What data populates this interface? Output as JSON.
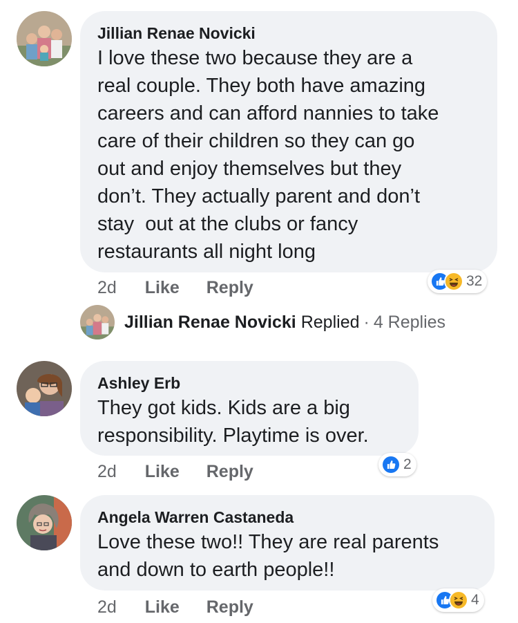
{
  "comments": [
    {
      "author": "Jillian Renae Novicki",
      "text": "I love these two because they are a\nreal couple. They both have amazing\ncareers and can afford nannies to take\ncare of their children so they can go\nout and enjoy themselves but they\ndon’t. They actually parent and don’t\nstay  out at the clubs or fancy\nrestaurants all night long",
      "time": "2d",
      "like_label": "Like",
      "reply_label": "Reply",
      "reaction_icons": [
        "like-reaction",
        "haha-reaction"
      ],
      "reaction_count": "32"
    },
    {
      "author": "Ashley Erb",
      "text": "They got kids. Kids are a big\nresponsibility. Playtime is over.",
      "time": "2d",
      "like_label": "Like",
      "reply_label": "Reply",
      "reaction_icons": [
        "like-reaction"
      ],
      "reaction_count": "2"
    },
    {
      "author": "Angela Warren Castaneda",
      "text": "Love these two!! They are real parents\nand down to earth people!!",
      "time": "2d",
      "like_label": "Like",
      "reply_label": "Reply",
      "reaction_icons": [
        "like-reaction",
        "haha-reaction"
      ],
      "reaction_count": "4"
    }
  ],
  "replies_summary": {
    "replier": "Jillian Renae Novicki",
    "replied_label": "Replied",
    "separator": "·",
    "count_label": "4 Replies"
  },
  "colors": {
    "bubble": "#f0f2f5",
    "like_blue": "#1877f2",
    "haha_yellow": "#f7b928",
    "secondary_text": "#65676b"
  }
}
